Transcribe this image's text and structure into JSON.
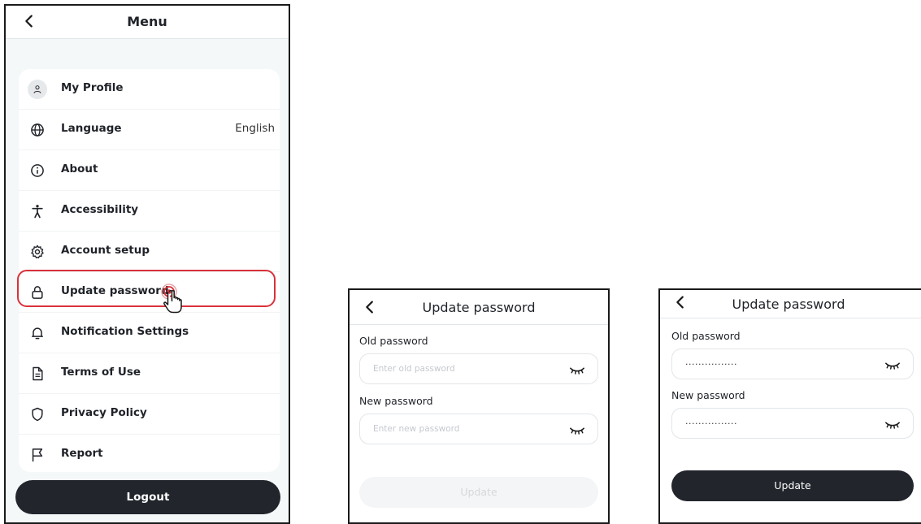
{
  "menu_screen": {
    "title": "Menu",
    "items": [
      {
        "label": "My Profile",
        "icon": "user-icon"
      },
      {
        "label": "Language",
        "icon": "globe-icon",
        "value": "English"
      },
      {
        "label": "About",
        "icon": "info-icon"
      },
      {
        "label": "Accessibility",
        "icon": "accessibility-icon"
      },
      {
        "label": "Account setup",
        "icon": "gear-icon"
      },
      {
        "label": "Update password",
        "icon": "lock-icon",
        "highlighted": true
      },
      {
        "label": "Notification Settings",
        "icon": "bell-icon"
      },
      {
        "label": "Terms of Use",
        "icon": "document-icon"
      },
      {
        "label": "Privacy Policy",
        "icon": "shield-icon"
      },
      {
        "label": "Report",
        "icon": "flag-icon"
      }
    ],
    "logout_label": "Logout"
  },
  "update_password_empty": {
    "title": "Update password",
    "old_label": "Old password",
    "old_placeholder": "Enter old password",
    "new_label": "New password",
    "new_placeholder": "Enter new password",
    "button_label": "Update"
  },
  "update_password_filled": {
    "title": "Update password",
    "old_label": "Old password",
    "old_value": "................",
    "new_label": "New password",
    "new_value": "................",
    "button_label": "Update"
  },
  "colors": {
    "highlight": "#d9323b",
    "button_dark": "#22252c",
    "menu_bg": "#f4f8f8"
  }
}
